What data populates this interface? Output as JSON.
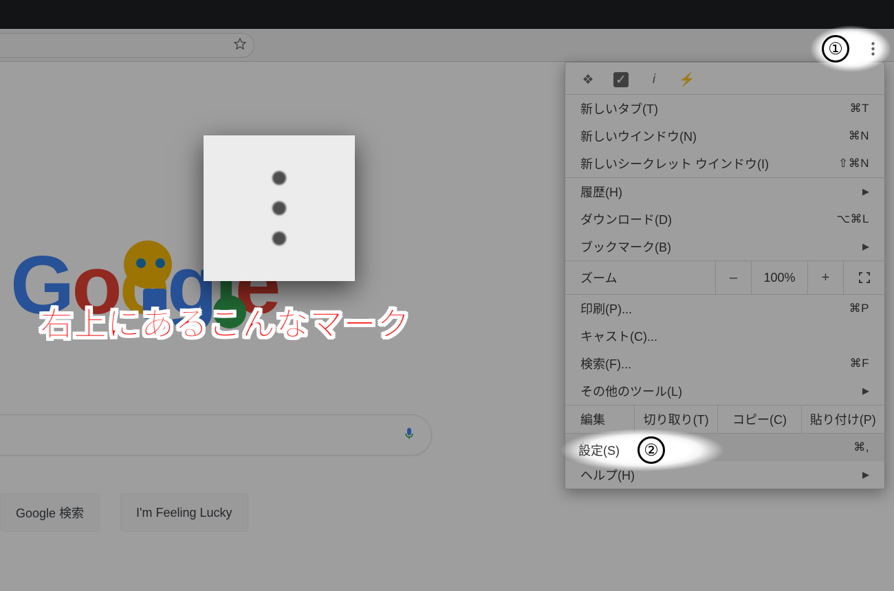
{
  "annotations": {
    "callout_text": "右上にあるこんなマーク",
    "badge1": "①",
    "badge2": "②",
    "highlighted_settings_label": "設定(S)"
  },
  "toolbar": {
    "zoom_value": "100%"
  },
  "buttons": {
    "search": "Google 検索",
    "lucky": "I'm Feeling Lucky"
  },
  "menu": {
    "new_tab": {
      "label": "新しいタブ(T)",
      "shortcut": "⌘T"
    },
    "new_window": {
      "label": "新しいウインドウ(N)",
      "shortcut": "⌘N"
    },
    "new_incognito": {
      "label": "新しいシークレット ウインドウ(I)",
      "shortcut": "⇧⌘N"
    },
    "history": {
      "label": "履歴(H)"
    },
    "downloads": {
      "label": "ダウンロード(D)",
      "shortcut": "⌥⌘L"
    },
    "bookmarks": {
      "label": "ブックマーク(B)"
    },
    "zoom_label": "ズーム",
    "print": {
      "label": "印刷(P)...",
      "shortcut": "⌘P"
    },
    "cast": {
      "label": "キャスト(C)..."
    },
    "find": {
      "label": "検索(F)...",
      "shortcut": "⌘F"
    },
    "more_tools": {
      "label": "その他のツール(L)"
    },
    "edit_label": "編集",
    "cut": "切り取り(T)",
    "copy": "コピー(C)",
    "paste": "貼り付け(P)",
    "settings": {
      "label": "設定(S)",
      "shortcut": "⌘,"
    },
    "help": {
      "label": "ヘルプ(H)"
    }
  }
}
